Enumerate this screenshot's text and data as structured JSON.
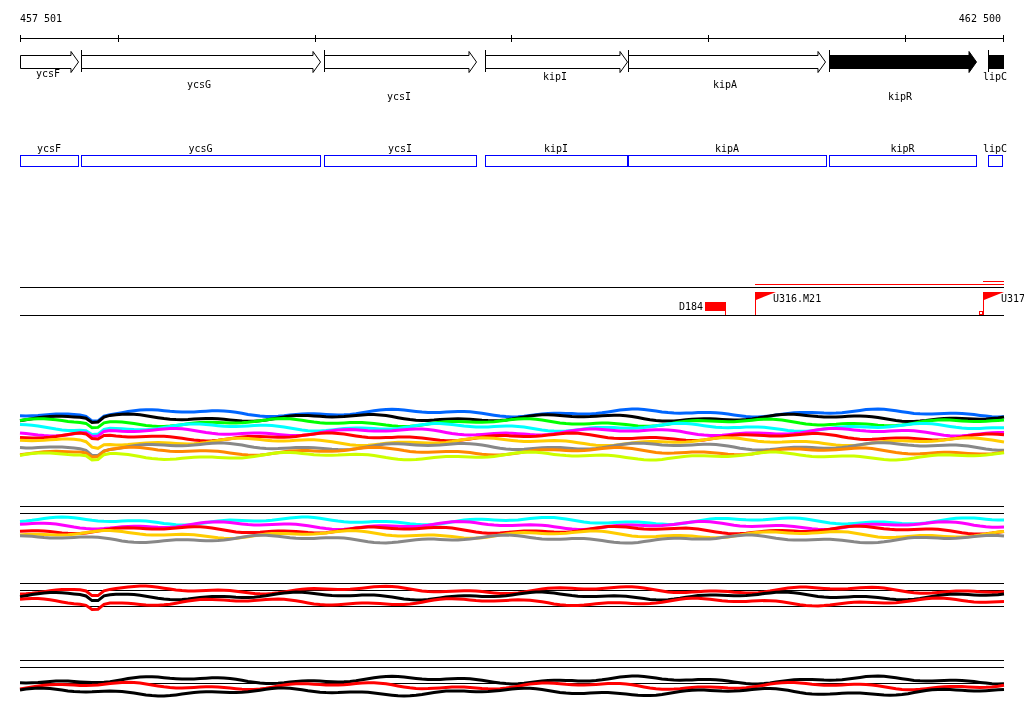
{
  "ruler": {
    "start": "457 501",
    "end": "462 500"
  },
  "genes": [
    {
      "name": "ycsF",
      "filled": false
    },
    {
      "name": "ycsG",
      "filled": false
    },
    {
      "name": "ycsI",
      "filled": false
    },
    {
      "name": "kipI",
      "filled": false
    },
    {
      "name": "kipA",
      "filled": false
    },
    {
      "name": "kipR",
      "filled": true
    },
    {
      "name": "lipC",
      "filled": true
    }
  ],
  "gene_boxes": [
    {
      "name": "ycsF"
    },
    {
      "name": "ycsG"
    },
    {
      "name": "ycsI"
    },
    {
      "name": "kipI"
    },
    {
      "name": "kipA"
    },
    {
      "name": "kipR"
    },
    {
      "name": "lipC"
    }
  ],
  "features": [
    {
      "label": "D184",
      "kind": "block"
    },
    {
      "label": "U316.M21",
      "kind": "flag"
    },
    {
      "label": "U317",
      "kind": "flag"
    }
  ]
}
